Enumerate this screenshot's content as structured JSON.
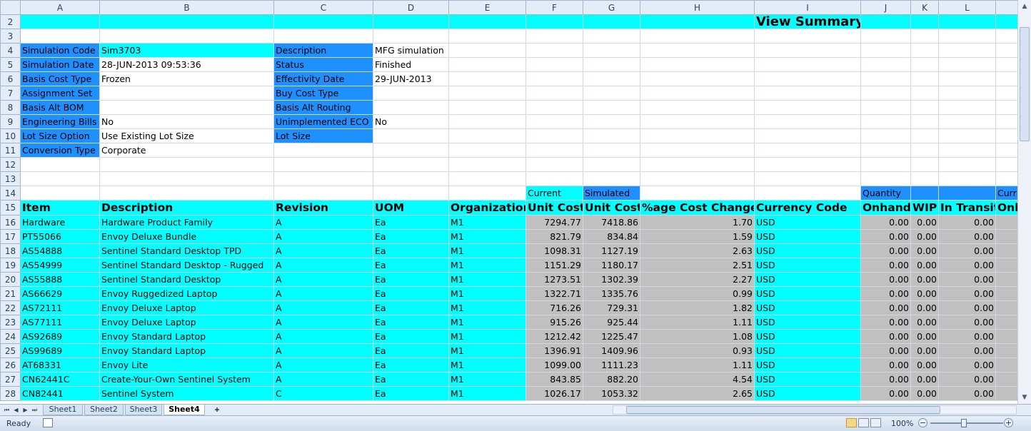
{
  "columns": [
    "A",
    "B",
    "C",
    "D",
    "E",
    "F",
    "G",
    "H",
    "I",
    "J",
    "K",
    "L",
    ""
  ],
  "row_numbers": [
    "2",
    "3",
    "4",
    "5",
    "6",
    "7",
    "8",
    "9",
    "10",
    "11",
    "12",
    "13",
    "14",
    "15",
    "16",
    "17",
    "18",
    "19",
    "20",
    "21",
    "22",
    "23",
    "24",
    "25",
    "26",
    "27",
    "28"
  ],
  "title": "View Summary",
  "params_left": [
    {
      "label": "Simulation Code",
      "value": "Sim3703"
    },
    {
      "label": "Simulation Date",
      "value": "28-JUN-2013 09:53:36"
    },
    {
      "label": "Basis Cost Type",
      "value": "Frozen"
    },
    {
      "label": "Assignment Set",
      "value": ""
    },
    {
      "label": "Basis Alt BOM",
      "value": ""
    },
    {
      "label": "Engineering Bills",
      "value": "No"
    },
    {
      "label": "Lot Size Option",
      "value": "Use Existing Lot Size"
    },
    {
      "label": "Conversion Type",
      "value": "Corporate"
    }
  ],
  "params_right": [
    {
      "label": "Description",
      "value": "MFG simulation"
    },
    {
      "label": "Status",
      "value": "Finished"
    },
    {
      "label": "Effectivity Date",
      "value": "29-JUN-2013"
    },
    {
      "label": "Buy Cost Type",
      "value": ""
    },
    {
      "label": "Basis Alt Routing",
      "value": ""
    },
    {
      "label": "Unimplemented ECO",
      "value": "No"
    },
    {
      "label": "Lot Size",
      "value": ""
    }
  ],
  "group_headers": {
    "current": "Current",
    "simulated": "Simulated",
    "quantity": "Quantity",
    "current_m": "Curr"
  },
  "headers": [
    "Item",
    "Description",
    "Revision",
    "UOM",
    "Organization",
    "Unit Cost",
    "Unit Cost",
    "%age Cost Change",
    "Currency Code",
    "Onhand",
    "WIP",
    "In Transit",
    "Onh"
  ],
  "rows": [
    [
      "Hardware",
      "Hardware Product Family",
      "A",
      "Ea",
      "M1",
      "7294.77",
      "7418.86",
      "1.70",
      "USD",
      "0.00",
      "0.00",
      "0.00"
    ],
    [
      "PT55066",
      "Envoy Deluxe Bundle",
      "A",
      "Ea",
      "M1",
      "821.79",
      "834.84",
      "1.59",
      "USD",
      "0.00",
      "0.00",
      "0.00"
    ],
    [
      "AS54888",
      "Sentinel Standard Desktop TPD",
      "A",
      "Ea",
      "M1",
      "1098.31",
      "1127.19",
      "2.63",
      "USD",
      "0.00",
      "0.00",
      "0.00"
    ],
    [
      "AS54999",
      "Sentinel Standard Desktop - Rugged",
      "A",
      "Ea",
      "M1",
      "1151.29",
      "1180.17",
      "2.51",
      "USD",
      "0.00",
      "0.00",
      "0.00"
    ],
    [
      "AS55888",
      "Sentinel Standard Desktop",
      "A",
      "Ea",
      "M1",
      "1273.51",
      "1302.39",
      "2.27",
      "USD",
      "0.00",
      "0.00",
      "0.00"
    ],
    [
      "AS66629",
      "Envoy Ruggedized Laptop",
      "A",
      "Ea",
      "M1",
      "1322.71",
      "1335.76",
      "0.99",
      "USD",
      "0.00",
      "0.00",
      "0.00"
    ],
    [
      "AS72111",
      "Envoy Deluxe Laptop",
      "A",
      "Ea",
      "M1",
      "716.26",
      "729.31",
      "1.82",
      "USD",
      "0.00",
      "0.00",
      "0.00"
    ],
    [
      "AS77111",
      "Envoy Deluxe Laptop",
      "A",
      "Ea",
      "M1",
      "915.26",
      "925.44",
      "1.11",
      "USD",
      "0.00",
      "0.00",
      "0.00"
    ],
    [
      "AS92689",
      "Envoy Standard Laptop",
      "A",
      "Ea",
      "M1",
      "1212.42",
      "1225.47",
      "1.08",
      "USD",
      "0.00",
      "0.00",
      "0.00"
    ],
    [
      "AS99689",
      "Envoy Standard Laptop",
      "A",
      "Ea",
      "M1",
      "1396.91",
      "1409.96",
      "0.93",
      "USD",
      "0.00",
      "0.00",
      "0.00"
    ],
    [
      "AT68331",
      "Envoy Lite",
      "A",
      "Ea",
      "M1",
      "1099.00",
      "1111.23",
      "1.11",
      "USD",
      "0.00",
      "0.00",
      "0.00"
    ],
    [
      "CN62441C",
      "Create-Your-Own Sentinel System",
      "A",
      "Ea",
      "M1",
      "843.85",
      "882.20",
      "4.54",
      "USD",
      "0.00",
      "0.00",
      "0.00"
    ],
    [
      "CN82441",
      "Sentinel System",
      "C",
      "Ea",
      "M1",
      "1026.17",
      "1053.32",
      "2.65",
      "USD",
      "0.00",
      "0.00",
      "0.00"
    ]
  ],
  "sheet_tabs": [
    "Sheet1",
    "Sheet2",
    "Sheet3",
    "Sheet4"
  ],
  "active_tab": "Sheet4",
  "status": {
    "ready": "Ready",
    "zoom": "100%"
  },
  "colors": {
    "cyan": "#00ffff",
    "blue": "#1e90ff",
    "grey": "#c0c0c0"
  }
}
